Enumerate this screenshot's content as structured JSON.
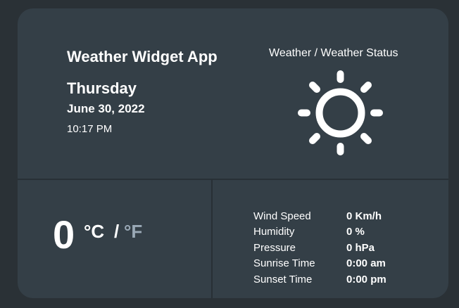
{
  "header": {
    "app_title": "Weather Widget App",
    "day": "Thursday",
    "date": "June 30, 2022",
    "time": "10:17 PM"
  },
  "status": {
    "label": "Weather / Weather Status",
    "icon": "sun-icon"
  },
  "temperature": {
    "value": "0",
    "unit_c": "°C",
    "separator": "/",
    "unit_f": "°F"
  },
  "stats": [
    {
      "label": "Wind Speed",
      "value": "0 Km/h"
    },
    {
      "label": "Humidity",
      "value": "0 %"
    },
    {
      "label": "Pressure",
      "value": "0 hPa"
    },
    {
      "label": "Sunrise Time",
      "value": "0:00 am"
    },
    {
      "label": "Sunset Time",
      "value": "0:00 pm"
    }
  ],
  "colors": {
    "background": "#2a3136",
    "card": "#343f47",
    "divider": "#283036",
    "text": "#ffffff",
    "inactive_unit": "#9aa9b6"
  }
}
